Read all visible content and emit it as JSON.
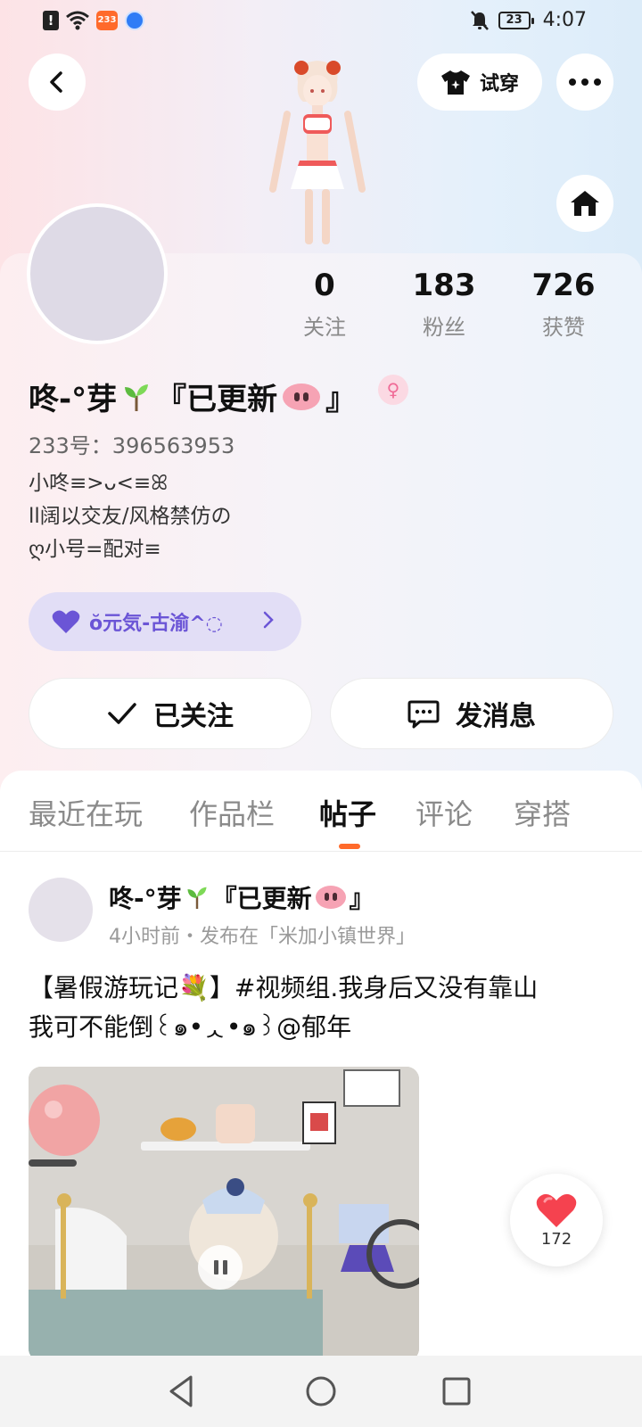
{
  "status_bar": {
    "time": "4:07",
    "battery": "23",
    "app_badge": "233",
    "icons": [
      "alert-icon",
      "wifi-icon",
      "app-233-icon",
      "bubble-icon",
      "mute-icon",
      "battery-icon"
    ]
  },
  "header": {
    "try_on_label": "试穿"
  },
  "stats": [
    {
      "value": "0",
      "label": "关注"
    },
    {
      "value": "183",
      "label": "粉丝"
    },
    {
      "value": "726",
      "label": "获赞"
    }
  ],
  "profile": {
    "name_prefix": "咚-°芽",
    "name_suffix_open": "『已更新",
    "name_suffix_close": "』",
    "gender_symbol": "♀",
    "user_id": "233号：396563953",
    "bio_lines": [
      "小咚≡>ᴗ<≡ꕤ",
      "ll阔以交友/风格禁仿の",
      "ღ小号=配对≡"
    ]
  },
  "guild": {
    "label": "ŏ元気-古渝^◌"
  },
  "actions": {
    "follow_label": "已关注",
    "message_label": "发消息"
  },
  "tabs": [
    {
      "label": "最近在玩",
      "active": false
    },
    {
      "label": "作品栏",
      "active": false
    },
    {
      "label": "帖子",
      "active": true
    },
    {
      "label": "评论",
      "active": false
    },
    {
      "label": "穿搭",
      "active": false
    }
  ],
  "post": {
    "author_prefix": "咚-°芽",
    "author_open": "『已更新",
    "author_close": "』",
    "meta": "4小时前・发布在「米加小镇世界」",
    "text_line1": "【暑假游玩记💐】#视频组.我身后又没有靠山",
    "text_line2": "我可不能倒꒰๑•ᆺ•๑꒱@郁年"
  },
  "like": {
    "count": "172"
  },
  "colors": {
    "accent_orange": "#ff6a2b",
    "guild_purple": "#6b55d6",
    "heart_red": "#f5424f"
  }
}
